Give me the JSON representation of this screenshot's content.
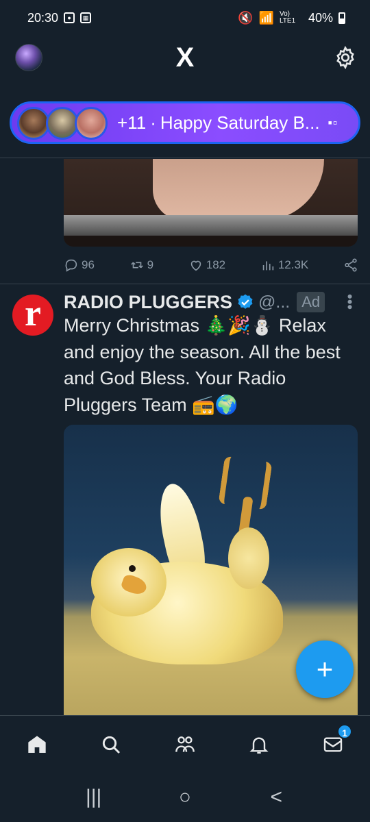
{
  "status_bar": {
    "time": "20:30",
    "signal_text": "Vo) LTE1",
    "battery": "40%"
  },
  "header": {
    "logo": "X",
    "icons": {
      "profile": "avatar",
      "settings": "gear-icon"
    }
  },
  "spaces": {
    "count_text": "+11",
    "title": "Happy Saturday B...",
    "separator": "·"
  },
  "previous_tweet": {
    "replies": "96",
    "reposts": "9",
    "likes": "182",
    "views": "12.3K"
  },
  "ad_tweet": {
    "avatar_letter": "r",
    "name": "RADIO PLUGGERS",
    "handle": "@...",
    "ad_label": "Ad",
    "text": "Merry Christmas 🎄🎉⛄ Relax and enjoy the season. All the best and God Bless. Your Radio Pluggers Team 📻🌍"
  },
  "fab": {
    "label": "+"
  },
  "bottom_nav": {
    "items": [
      "home-icon",
      "search-icon",
      "communities-icon",
      "notifications-icon",
      "messages-icon"
    ],
    "messages_badge": "1"
  },
  "system_nav": {
    "recents": "|||",
    "home": "○",
    "back": "<"
  },
  "colors": {
    "background": "#15202b",
    "accent": "#1d9bf0",
    "spaces_gradient": "#7b46f5",
    "muted_text": "#8b98a5"
  }
}
